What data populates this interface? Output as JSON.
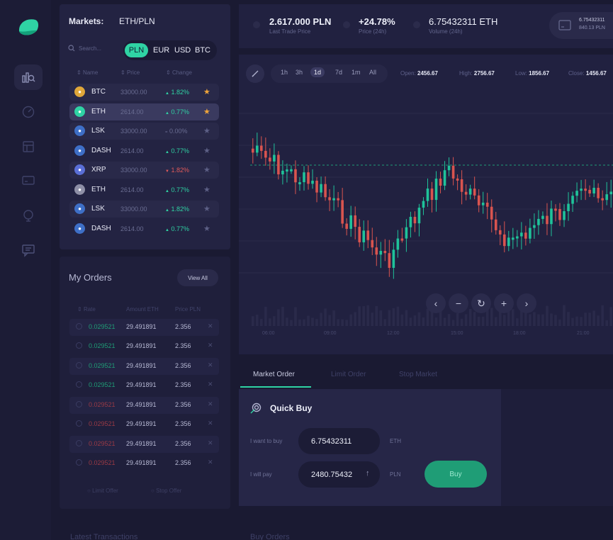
{
  "markets": {
    "title": "Markets:",
    "pair": "ETH/PLN",
    "search_placeholder": "Search...",
    "currencies": [
      "PLN",
      "EUR",
      "USD",
      "BTC"
    ],
    "active_currency": "PLN",
    "columns": [
      "Name",
      "Price",
      "Change"
    ],
    "rows": [
      {
        "name": "BTC",
        "price": "33000.00",
        "change": "1.82%",
        "dir": "up",
        "star": true,
        "icon": "bitcoin-icon",
        "color": "#e0a73a"
      },
      {
        "name": "ETH",
        "price": "2614.00",
        "change": "0.77%",
        "dir": "up",
        "star": true,
        "icon": "ethereum-icon",
        "color": "#2fd3a4"
      },
      {
        "name": "LSK",
        "price": "33000.00",
        "change": "0.00%",
        "dir": "flat",
        "star": false,
        "icon": "lisk-icon",
        "color": "#3e6fc7"
      },
      {
        "name": "DASH",
        "price": "2614.00",
        "change": "0.77%",
        "dir": "up",
        "star": false,
        "icon": "dash-icon",
        "color": "#3e6fc7"
      },
      {
        "name": "XRP",
        "price": "33000.00",
        "change": "1.82%",
        "dir": "down",
        "star": false,
        "icon": "ripple-icon",
        "color": "#5a6fd6"
      },
      {
        "name": "ETH",
        "price": "2614.00",
        "change": "0.77%",
        "dir": "up",
        "star": false,
        "icon": "ethereum-icon",
        "color": "#8e8fa6"
      },
      {
        "name": "LSK",
        "price": "33000.00",
        "change": "1.82%",
        "dir": "up",
        "star": false,
        "icon": "lisk-icon",
        "color": "#3e6fc7"
      },
      {
        "name": "DASH",
        "price": "2614.00",
        "change": "0.77%",
        "dir": "up",
        "star": false,
        "icon": "dash-icon",
        "color": "#3e6fc7"
      }
    ]
  },
  "orders": {
    "title": "My Orders",
    "view_all": "View All",
    "columns": [
      "Rate",
      "Amount ETH",
      "Price PLN"
    ],
    "rows": [
      {
        "rate": "0.029521",
        "amount": "29.491891",
        "price": "2.356",
        "side": "buy"
      },
      {
        "rate": "0.029521",
        "amount": "29.491891",
        "price": "2.356",
        "side": "buy"
      },
      {
        "rate": "0.029521",
        "amount": "29.491891",
        "price": "2.356",
        "side": "buy"
      },
      {
        "rate": "0.029521",
        "amount": "29.491891",
        "price": "2.356",
        "side": "buy"
      },
      {
        "rate": "0.029521",
        "amount": "29.491891",
        "price": "2.356",
        "side": "sell"
      },
      {
        "rate": "0.029521",
        "amount": "29.491891",
        "price": "2.356",
        "side": "sell"
      },
      {
        "rate": "0.029521",
        "amount": "29.491891",
        "price": "2.356",
        "side": "sell"
      },
      {
        "rate": "0.029521",
        "amount": "29.491891",
        "price": "2.356",
        "side": "sell"
      }
    ],
    "limit_offer": "Limit Offer",
    "stop_offer": "Stop Offer"
  },
  "topbar": {
    "last_price": "2.617.000 PLN",
    "last_price_label": "Last Trade Price",
    "change": "+24.78%",
    "change_label": "Price (24h)",
    "volume": "6.75432311 ETH",
    "volume_label": "Volume (24h)",
    "wallet_eth": "6.75432311",
    "wallet_pln": "840.13 PLN"
  },
  "chart": {
    "timeframes": [
      "1h",
      "3h",
      "1d",
      "7d",
      "1m",
      "All"
    ],
    "active_timeframe": "1d",
    "open_label": "Open:",
    "open": "2456.67",
    "high_label": "High:",
    "high": "2756.67",
    "low_label": "Low:",
    "low": "1856.67",
    "close_label": "Close:",
    "close": "1456.67",
    "time_labels": [
      "06:00",
      "09:00",
      "12:00",
      "15:00",
      "18:00",
      "21:00"
    ]
  },
  "order_tabs": [
    "Market Order",
    "Limit Order",
    "Stop Market"
  ],
  "quick_buy": {
    "title": "Quick Buy",
    "want_label": "I want to buy",
    "want_value": "6.75432311",
    "want_unit": "ETH",
    "pay_label": "I will pay",
    "pay_value": "2480.75432",
    "pay_unit": "PLN",
    "buy_label": "Buy"
  },
  "footer": {
    "latest": "Latest Transactions",
    "buy_orders": "Buy Orders"
  },
  "colors": {
    "accent": "#2fd3a4",
    "down": "#e05a5a",
    "background": "#1a1a32"
  }
}
